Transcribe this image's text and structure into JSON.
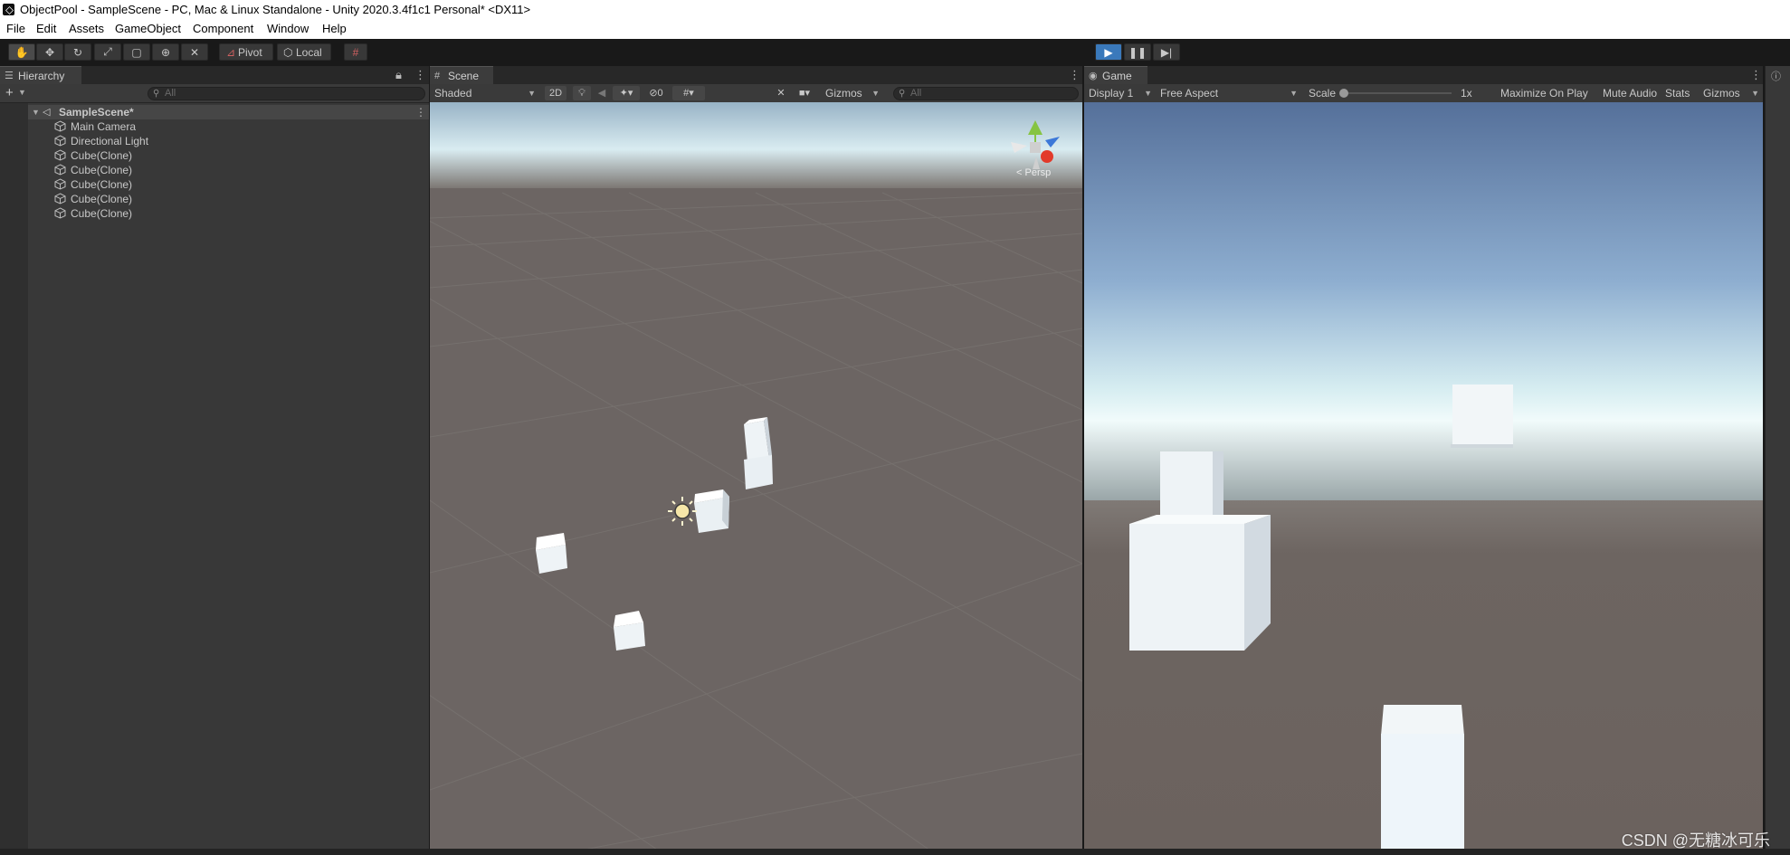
{
  "window": {
    "title": "ObjectPool - SampleScene - PC, Mac & Linux Standalone - Unity 2020.3.4f1c1 Personal* <DX11>"
  },
  "menu": [
    "File",
    "Edit",
    "Assets",
    "GameObject",
    "Component",
    "Window",
    "Help"
  ],
  "toolbar": {
    "tools": [
      "hand-tool",
      "move-tool",
      "rotate-tool",
      "scale-tool",
      "rect-tool",
      "transform-tool",
      "custom-tool"
    ],
    "pivot_label": "Pivot",
    "local_label": "Local",
    "play_state": "playing"
  },
  "hierarchy": {
    "tab_label": "Hierarchy",
    "search_placeholder": "All",
    "scene_name": "SampleScene*",
    "items": [
      "Main Camera",
      "Directional Light",
      "Cube(Clone)",
      "Cube(Clone)",
      "Cube(Clone)",
      "Cube(Clone)",
      "Cube(Clone)"
    ]
  },
  "scene": {
    "tab_label": "Scene",
    "shading_mode": "Shaded",
    "mode_2d_label": "2D",
    "hidden_count": "0",
    "gizmos_label": "Gizmos",
    "search_placeholder": "All",
    "persp_label": "Persp",
    "gizmo_axes": [
      "y",
      "x",
      "z"
    ]
  },
  "game": {
    "tab_label": "Game",
    "display": "Display 1",
    "aspect": "Free Aspect",
    "scale_label": "Scale",
    "scale_value": "1x",
    "maximize_label": "Maximize On Play",
    "mute_label": "Mute Audio",
    "stats_label": "Stats",
    "gizmos_label": "Gizmos"
  },
  "watermark": "CSDN @无糖冰可乐",
  "colors": {
    "editor_bg": "#383838",
    "play_active": "#3a79bb",
    "sky_top": "#5b7aa6",
    "horizon": "#eaf6f8",
    "ground": "#6b625e"
  }
}
